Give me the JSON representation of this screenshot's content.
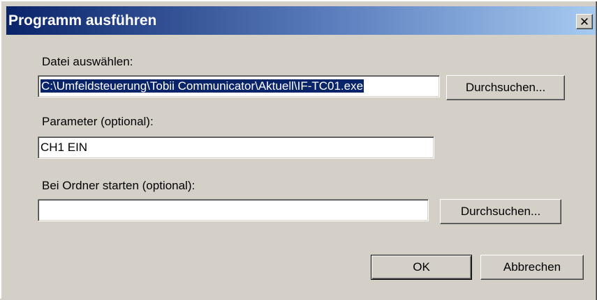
{
  "window": {
    "title": "Programm ausführen",
    "close_glyph": "✕"
  },
  "file": {
    "label": "Datei auswählen:",
    "value": "C:\\Umfeldsteuerung\\Tobii Communicator\\Aktuell\\IF-TC01.exe",
    "browse_label": "Durchsuchen..."
  },
  "params": {
    "label": "Parameter (optional):",
    "value": "CH1 EIN"
  },
  "startdir": {
    "label": "Bei Ordner starten (optional):",
    "value": "",
    "browse_label": "Durchsuchen..."
  },
  "buttons": {
    "ok_label": "OK",
    "cancel_label": "Abbrechen"
  },
  "colors": {
    "title_gradient_start": "#0a246a",
    "title_gradient_end": "#a6caf0",
    "dialog_face": "#d4d0c8",
    "selection": "#0a246a"
  }
}
